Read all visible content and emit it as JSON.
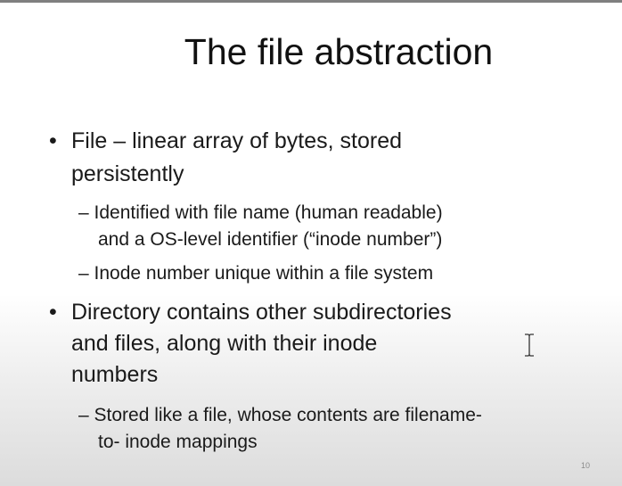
{
  "slide": {
    "title": "The file abstraction",
    "bullet_1": {
      "line_1": "File – linear array of bytes, stored",
      "line_2": "persistently",
      "subs": [
        {
          "line_1": "– Identified with file name (human readable)",
          "line_2": "and a  OS-level identifier (“inode number”)"
        },
        {
          "line_1": "– Inode number unique within a file system"
        }
      ]
    },
    "bullet_2": {
      "line_1": "Directory contains other subdirectories",
      "line_2": "and  files, along with their inode",
      "line_3": "numbers",
      "subs": [
        {
          "line_1": "– Stored like a file, whose contents are filename-",
          "line_2": "to-  inode mappings"
        }
      ]
    },
    "bullet_symbol": "•",
    "page_number": "10"
  },
  "cursor": {
    "icon": "text-cursor-icon"
  },
  "colors": {
    "text": "#1a1a1a",
    "top_border": "#7f7f7f",
    "page_number": "#8a8a8a"
  }
}
